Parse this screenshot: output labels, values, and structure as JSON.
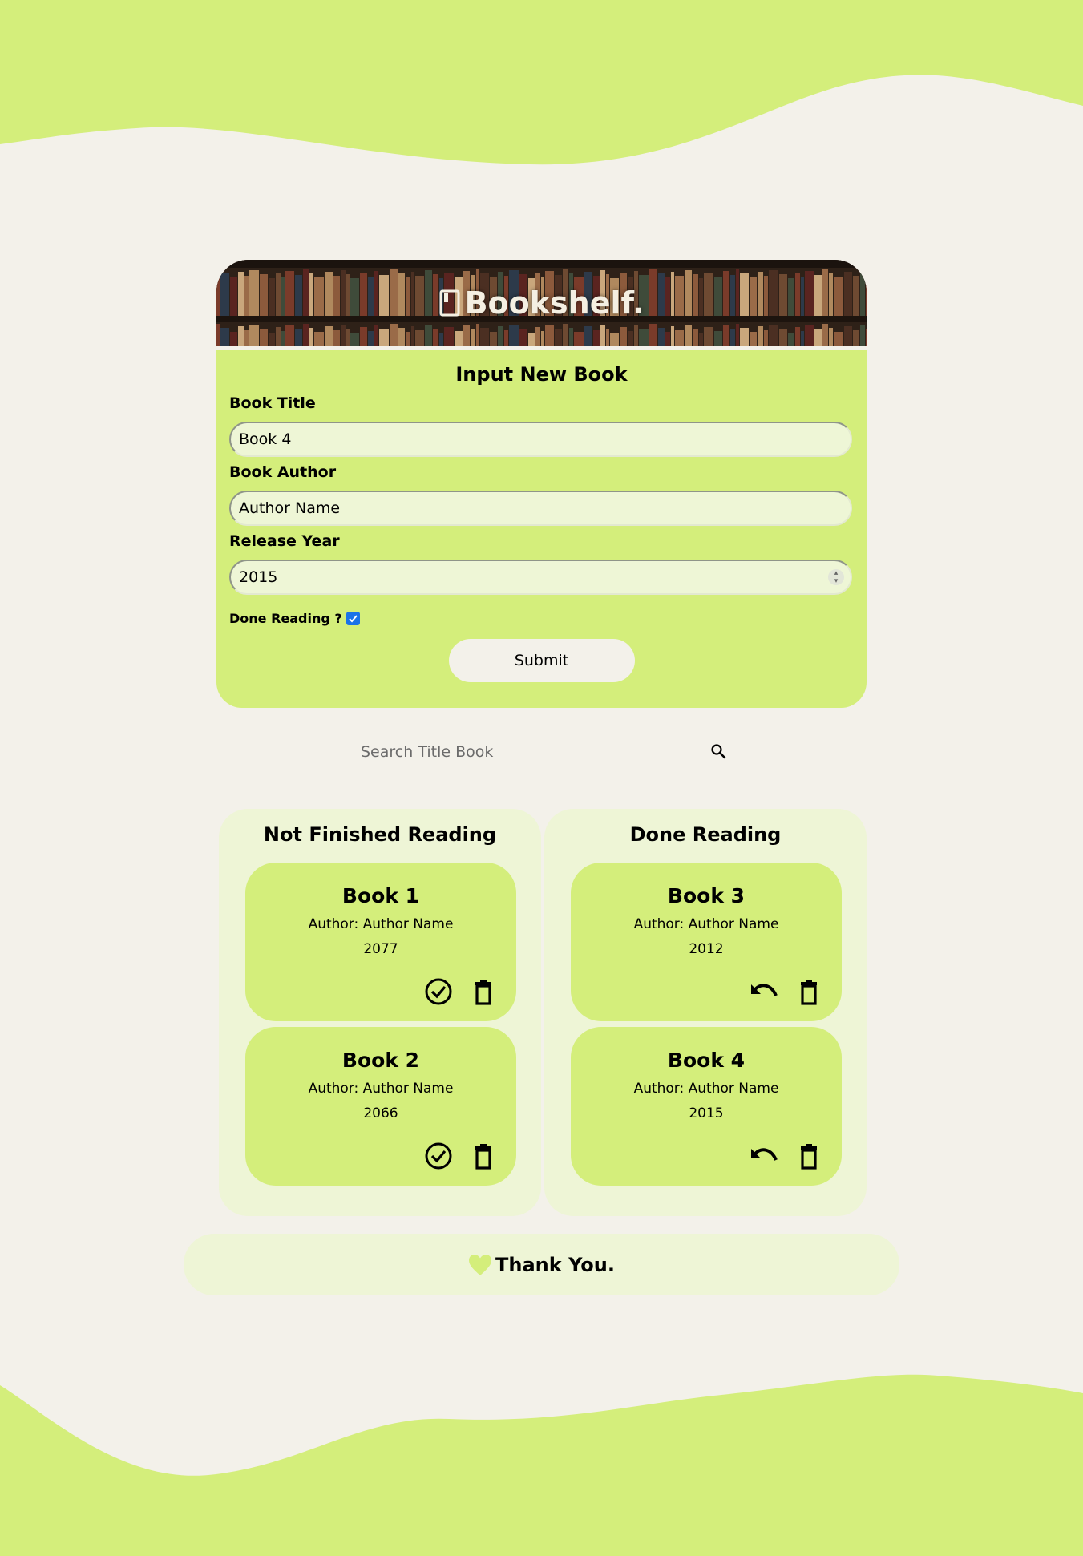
{
  "colors": {
    "background": "#f3f1ea",
    "accent": "#d4ee7b",
    "panel": "#eef5d6",
    "checkbox": "#1a73e8"
  },
  "header": {
    "brand": "Bookshelf.",
    "icon": "book-icon"
  },
  "form": {
    "title": "Input New Book",
    "title_label": "Book Title",
    "title_value": "Book 4",
    "author_label": "Book Author",
    "author_value": "Author Name",
    "year_label": "Release Year",
    "year_value": "2015",
    "done_label": "Done Reading ?",
    "done_checked": true,
    "submit_label": "Submit"
  },
  "search": {
    "placeholder": "Search Title Book",
    "icon": "search-icon"
  },
  "shelves": {
    "not_finished": {
      "title": "Not Finished Reading",
      "books": [
        {
          "title": "Book 1",
          "author": "Author: Author Name",
          "year": "2077",
          "action_icon": "check-circle-icon"
        },
        {
          "title": "Book 2",
          "author": "Author: Author Name",
          "year": "2066",
          "action_icon": "check-circle-icon"
        }
      ]
    },
    "done": {
      "title": "Done Reading",
      "books": [
        {
          "title": "Book 3",
          "author": "Author: Author Name",
          "year": "2012",
          "action_icon": "undo-icon"
        },
        {
          "title": "Book 4",
          "author": "Author: Author Name",
          "year": "2015",
          "action_icon": "undo-icon"
        }
      ]
    }
  },
  "footer": {
    "text": "Thank You.",
    "icon": "heart-icon"
  }
}
